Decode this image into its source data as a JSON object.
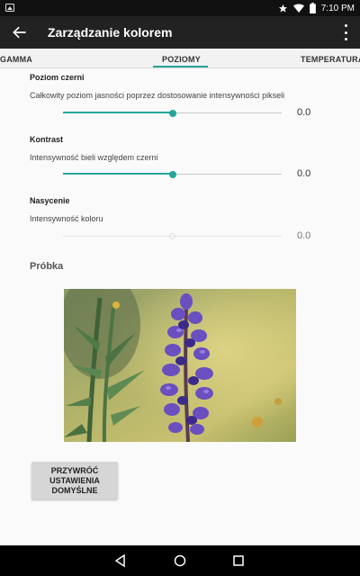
{
  "status": {
    "time": "7:10 PM"
  },
  "appbar": {
    "title": "Zarządzanie kolorem"
  },
  "tabs": [
    {
      "label": "GAMMA"
    },
    {
      "label": "POZIOMY"
    },
    {
      "label": "TEMPERATURA"
    }
  ],
  "settings": [
    {
      "name": "Poziom czerni",
      "description": "Całkowity poziom jasności poprzez dostosowanie intensywności pikseli",
      "value": "0.0",
      "level": 0.5,
      "enabled": true
    },
    {
      "name": "Kontrast",
      "description": "Intensywność bieli względem czerni",
      "value": "0.0",
      "level": 0.5,
      "enabled": true
    },
    {
      "name": "Nasycenie",
      "description": "Intensywność koloru",
      "value": "0.0",
      "level": 0.5,
      "enabled": false
    }
  ],
  "sample": {
    "title": "Próbka"
  },
  "reset_button": {
    "label": "PRZYWRÓĆ\nUSTAWIENIA\nDOMYŚLNE"
  },
  "colors": {
    "accent": "#26a69a",
    "appbar": "#222222"
  }
}
